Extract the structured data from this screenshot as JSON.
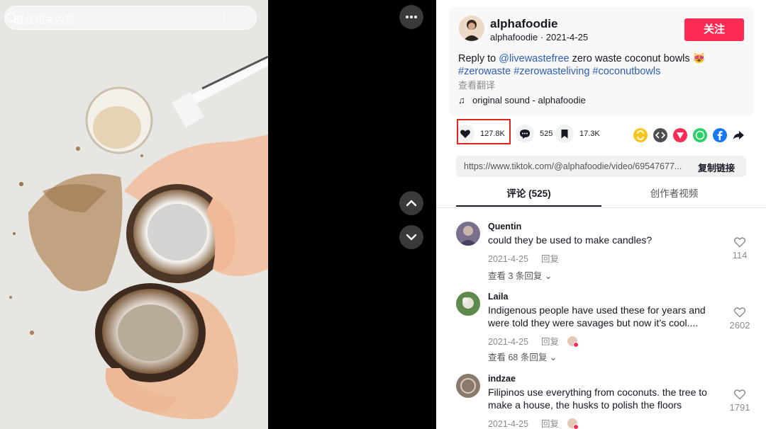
{
  "search": {
    "placeholder": "查找相关内容"
  },
  "author": {
    "name": "alphafoodie",
    "handle_date": "alphafoodie · 2021-4-25",
    "follow_label": "关注"
  },
  "caption": {
    "prefix": "Reply to ",
    "mention": "@livewastefree",
    "text": " zero waste coconut bowls 😻",
    "tags": [
      "#zerowaste",
      "#zerowasteliving",
      "#coconutbowls"
    ],
    "translate": "查看翻译"
  },
  "music": {
    "label": "original sound - alphafoodie"
  },
  "actions": {
    "likes": "127.8K",
    "comments": "525",
    "saves": "17.3K"
  },
  "share": {
    "icons": [
      "repost-icon",
      "embed-icon",
      "send-icon",
      "whatsapp-icon",
      "facebook-icon",
      "share-arrow-icon"
    ]
  },
  "link": {
    "url": "https://www.tiktok.com/@alphafoodie/video/69547677...",
    "copy_label": "复制链接"
  },
  "tabs": {
    "comments": "评论 (525)",
    "creator_videos": "创作者视频"
  },
  "comments": [
    {
      "user": "Quentin",
      "text": "could they be used to make candles?",
      "date": "2021-4-25",
      "reply": "回复",
      "likes": "114",
      "more": "查看 3 条回复"
    },
    {
      "user": "Laila",
      "text": "Indigenous people have used these for years and were told they were savages but now it’s cool....",
      "date": "2021-4-25",
      "reply": "回复",
      "likes": "2602",
      "more": "查看 68 条回复"
    },
    {
      "user": "indzae",
      "text": "Filipinos use everything from coconuts. the tree to make a house, the husks to polish the floors",
      "date": "2021-4-25",
      "reply": "回复",
      "likes": "1791"
    }
  ],
  "colors": {
    "accent": "#fe2c55",
    "link": "#2b5db9",
    "highlight": "#e2241b"
  }
}
